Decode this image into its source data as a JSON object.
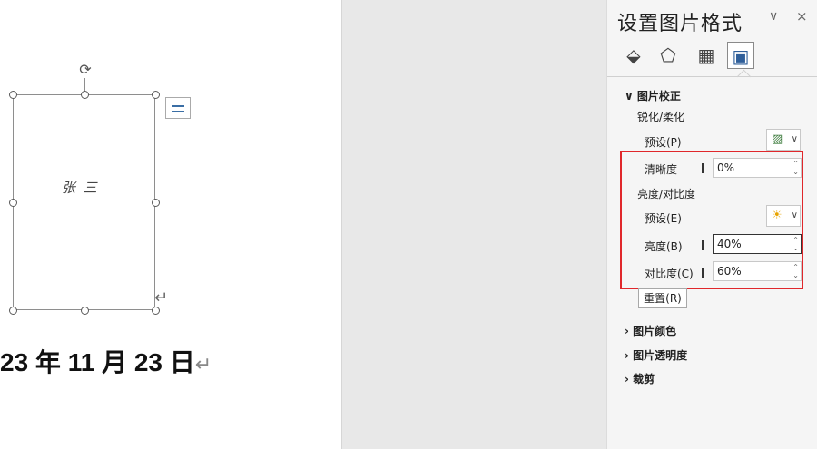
{
  "document": {
    "signature": "张 三",
    "date_text": "23 年 11 月 23 日"
  },
  "pane": {
    "title": "设置图片格式",
    "chevron": "∨",
    "close": "×",
    "tabs": [
      {
        "icon": "fill-line-icon",
        "glyph": "⬙"
      },
      {
        "icon": "effects-icon",
        "glyph": "⬠"
      },
      {
        "icon": "size-properties-icon",
        "glyph": "▦"
      },
      {
        "icon": "picture-icon",
        "glyph": "▣"
      }
    ],
    "picture_correction": {
      "header": "图片校正",
      "sharpen_soften": "锐化/柔化",
      "preset_p": "预设(P)",
      "sharpness_label": "清晰度",
      "sharpness_value": "0%",
      "brightness_contrast": "亮度/对比度",
      "preset_e": "预设(E)",
      "brightness_label": "亮度(B)",
      "brightness_value": "40%",
      "contrast_label": "对比度(C)",
      "contrast_value": "60%",
      "reset_label": "重置(R)"
    },
    "collapsed_sections": [
      "图片颜色",
      "图片透明度",
      "裁剪"
    ],
    "highlight_color": "#e0272b"
  }
}
